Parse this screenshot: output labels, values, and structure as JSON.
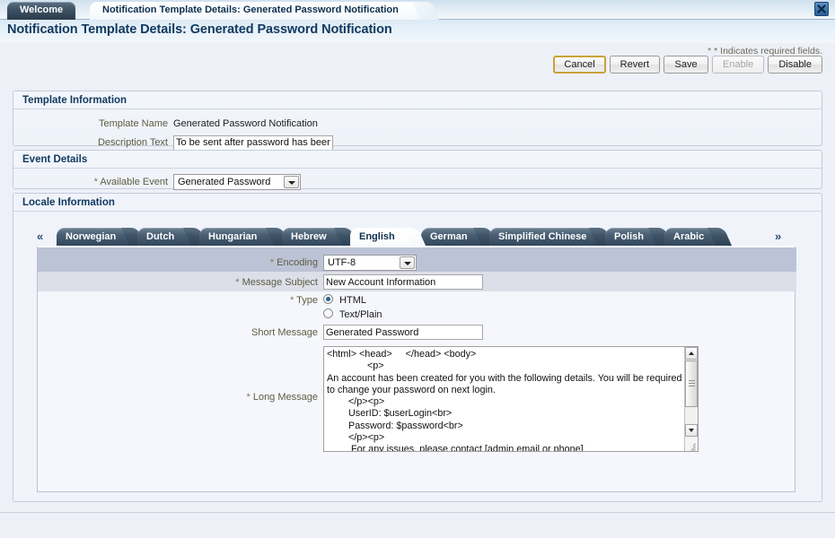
{
  "window": {
    "close_icon": "close-icon"
  },
  "top_tabs": [
    {
      "label": "Welcome",
      "active": false
    },
    {
      "label": "Notification Template Details: Generated Password Notification",
      "active": true
    }
  ],
  "header": {
    "page_title": "Notification Template Details: Generated Password Notification",
    "required_hint": "* Indicates required fields.",
    "required_star": "*"
  },
  "toolbar": {
    "cancel_label": "Cancel",
    "revert_label": "Revert",
    "save_label": "Save",
    "enable_label": "Enable",
    "disable_label": "Disable"
  },
  "template_information": {
    "section_title": "Template Information",
    "template_name_label": "Template Name",
    "template_name_value": "Generated Password Notification",
    "description_label": "Description Text",
    "description_value": "To be sent after password has been"
  },
  "event_details": {
    "section_title": "Event Details",
    "available_event_label": "Available Event",
    "available_event_value": "Generated Password",
    "required_star": "*"
  },
  "locale_information": {
    "section_title": "Locale Information",
    "scroll_left_icon": "«",
    "scroll_right_icon": "»",
    "tabs": [
      {
        "label": "Norwegian",
        "selected": false
      },
      {
        "label": "Dutch",
        "selected": false
      },
      {
        "label": "Hungarian",
        "selected": false
      },
      {
        "label": "Hebrew",
        "selected": false
      },
      {
        "label": "English",
        "selected": true
      },
      {
        "label": "German",
        "selected": false
      },
      {
        "label": "Simplified Chinese",
        "selected": false
      },
      {
        "label": "Polish",
        "selected": false
      },
      {
        "label": "Arabic",
        "selected": false
      }
    ],
    "form": {
      "required_star": "*",
      "encoding_label": "Encoding",
      "encoding_value": "UTF-8",
      "message_subject_label": "Message Subject",
      "message_subject_value": "New Account Information",
      "type_label": "Type",
      "type_options": [
        {
          "label": "HTML",
          "selected": true
        },
        {
          "label": "Text/Plain",
          "selected": false
        }
      ],
      "short_message_label": "Short Message",
      "short_message_value": "Generated Password",
      "long_message_label": "Long Message",
      "long_message_value": "<html> <head>     </head> <body>\n               <p>\nAn account has been created for you with the following details. You will be required\nto change your password on next login.\n        </p><p>\n        UserID: $userLogin<br>\n        Password: $password<br>\n        </p><p>\n         For any issues, please contact [admin email or phone]"
    }
  }
}
